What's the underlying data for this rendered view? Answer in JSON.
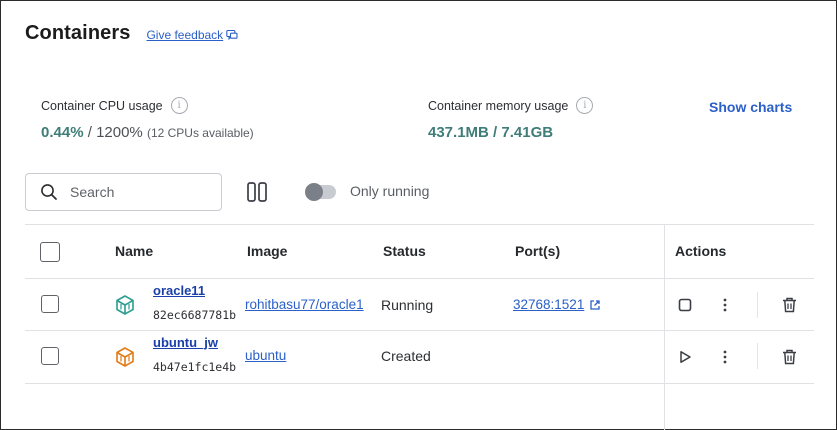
{
  "page": {
    "title": "Containers",
    "feedback_label": "Give feedback"
  },
  "stats": {
    "cpu": {
      "label": "Container CPU usage",
      "used": "0.44%",
      "sep": " / ",
      "total": "1200%",
      "note": "(12 CPUs available)"
    },
    "memory": {
      "label": "Container memory usage",
      "used": "437.1MB",
      "sep": " / ",
      "total": "7.41GB"
    },
    "show_charts_label": "Show charts"
  },
  "toolbar": {
    "search_placeholder": "Search",
    "only_running_label": "Only running",
    "only_running_enabled": false
  },
  "table": {
    "columns": {
      "name": "Name",
      "image": "Image",
      "status": "Status",
      "ports": "Port(s)",
      "actions": "Actions"
    },
    "rows": [
      {
        "name": "oracle11",
        "id": "82ec6687781b",
        "image": "rohitbasu77/oracle1",
        "status": "Running",
        "port": "32768:1521",
        "icon_color": "#2a9d8f",
        "icon": "container-running-icon"
      },
      {
        "name": "ubuntu_jw",
        "id": "4b47e1fc1e4b",
        "image": "ubuntu",
        "status": "Created",
        "port": "",
        "icon_color": "#e07b16",
        "icon": "container-stopped-icon"
      }
    ]
  },
  "colors": {
    "accent": "#2b60c8",
    "stat_highlight": "#3f7d77"
  }
}
